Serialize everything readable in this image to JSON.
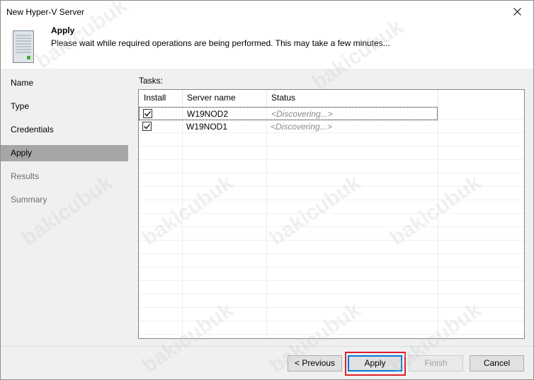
{
  "window": {
    "title": "New Hyper-V Server"
  },
  "header": {
    "title": "Apply",
    "description": "Please wait while required operations are being performed. This may take a few minutes..."
  },
  "nav": {
    "items": [
      {
        "label": "Name",
        "state": "normal"
      },
      {
        "label": "Type",
        "state": "normal"
      },
      {
        "label": "Credentials",
        "state": "normal"
      },
      {
        "label": "Apply",
        "state": "active"
      },
      {
        "label": "Results",
        "state": "disabled"
      },
      {
        "label": "Summary",
        "state": "disabled"
      }
    ]
  },
  "tasks": {
    "label": "Tasks:",
    "columns": [
      "Install",
      "Server name",
      "Status"
    ],
    "rows": [
      {
        "install": true,
        "server": "W19NOD2",
        "status": "<Discovering...>"
      },
      {
        "install": true,
        "server": "W19NOD1",
        "status": "<Discovering...>"
      }
    ]
  },
  "buttons": {
    "previous": "< Previous",
    "apply": "Apply",
    "finish": "Finish",
    "cancel": "Cancel"
  },
  "watermark": "bakicubuk",
  "colors": {
    "active_nav": "#a6a6a6",
    "highlight_border": "#d9232e",
    "focus_button_border": "#0078d7"
  }
}
